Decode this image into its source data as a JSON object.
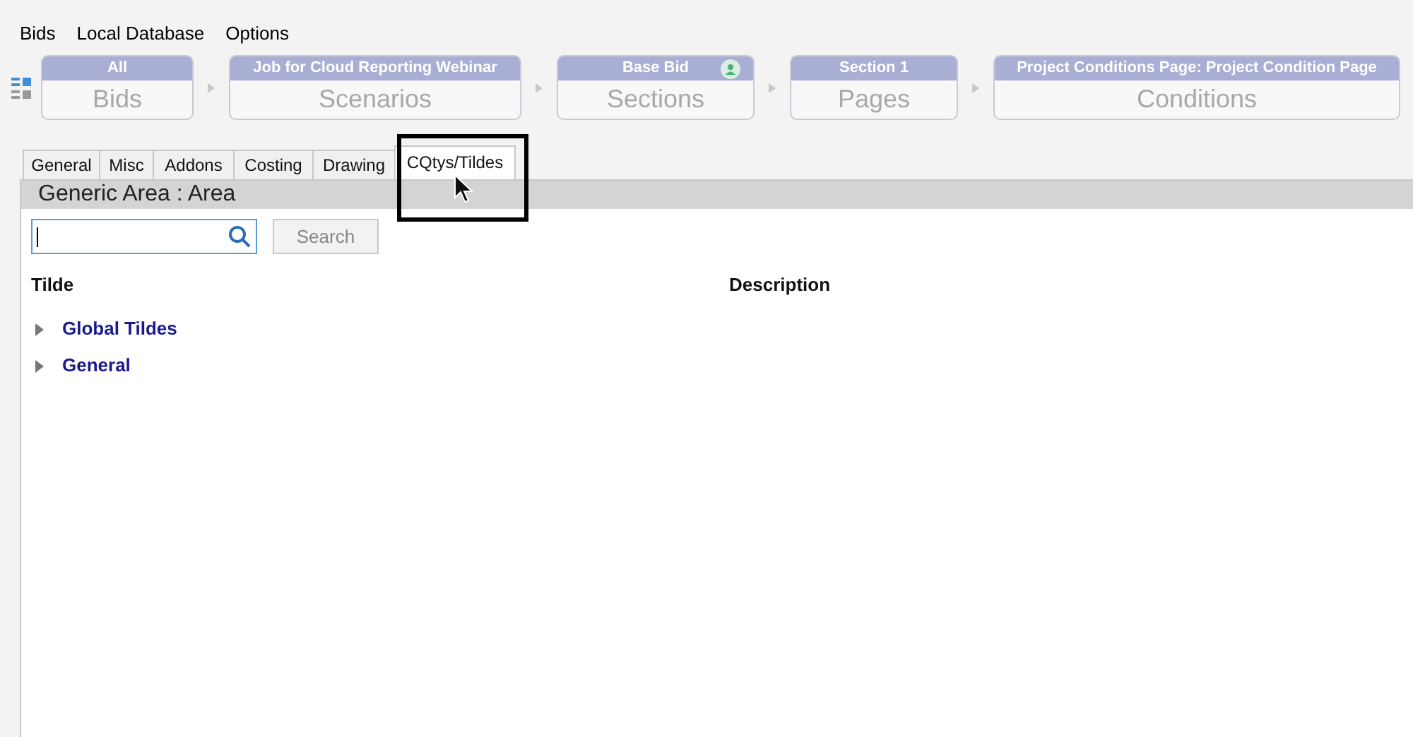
{
  "menu": [
    "Bids",
    "Local Database",
    "Options"
  ],
  "breadcrumbs": [
    {
      "header": "All",
      "label": "Bids",
      "badge": false
    },
    {
      "header": "Job for Cloud Reporting Webinar",
      "label": "Scenarios",
      "badge": false
    },
    {
      "header": "Base Bid",
      "label": "Sections",
      "badge": true
    },
    {
      "header": "Section 1",
      "label": "Pages",
      "badge": false
    },
    {
      "header": "Project Conditions Page: Project Condition Page",
      "label": "Conditions",
      "badge": false
    }
  ],
  "tabs": [
    {
      "label": "General",
      "selected": false
    },
    {
      "label": "Misc",
      "selected": false
    },
    {
      "label": "Addons",
      "selected": false
    },
    {
      "label": "Costing",
      "selected": false
    },
    {
      "label": "Drawing",
      "selected": false
    },
    {
      "label": "CQtys/Tildes",
      "selected": true
    }
  ],
  "panel_title": "Generic Area : Area",
  "search": {
    "button": "Search"
  },
  "table": {
    "columns": [
      "Tilde",
      "Description"
    ],
    "rows": [
      {
        "label": "Global Tildes",
        "expanded": false
      },
      {
        "label": "General",
        "expanded": false
      }
    ]
  }
}
